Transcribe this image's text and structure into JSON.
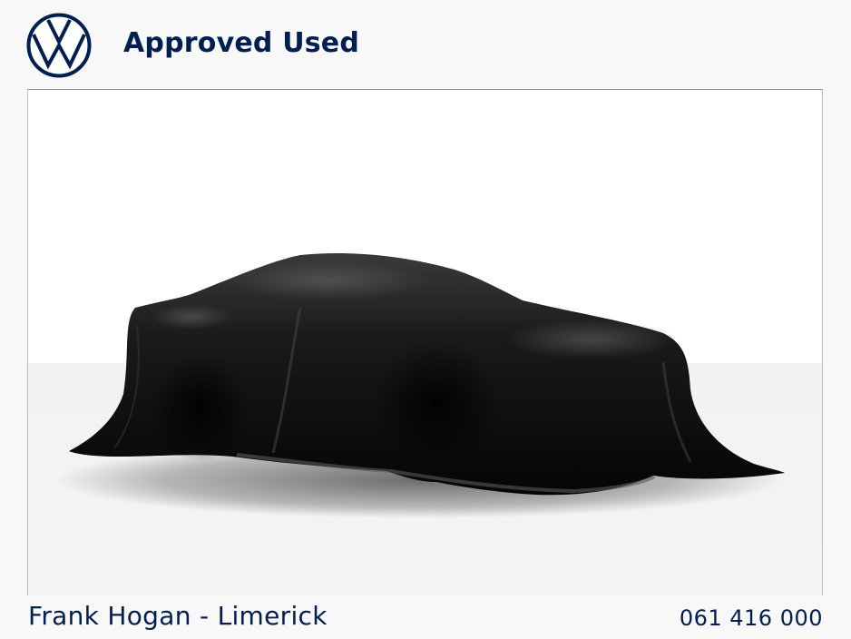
{
  "header": {
    "logo_icon": "vw-logo-icon",
    "brand_color": "#001e50",
    "headline": "Approved Used"
  },
  "photo": {
    "subject": "covered-car-placeholder",
    "cover_color": "#0a0a0a"
  },
  "footer": {
    "dealer_name": "Frank Hogan - Limerick",
    "phone": "061 416 000"
  }
}
